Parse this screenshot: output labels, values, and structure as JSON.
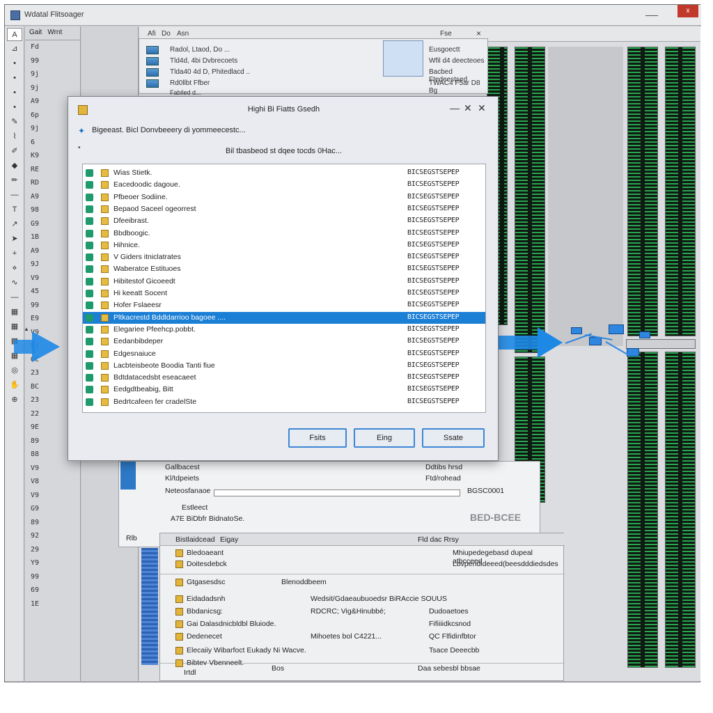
{
  "window": {
    "title": "Wdatal Flitsoager",
    "close_label": "x"
  },
  "left_toolbar": {
    "icons": [
      "t-icon",
      "ruler-icon",
      "dot-icon",
      "dot-icon",
      "dot-icon",
      "dot-icon",
      "pen-icon",
      "brush-icon",
      "pencil-icon",
      "shape-icon",
      "marker-icon",
      "line-icon",
      "text-icon",
      "arrow-icon",
      "cursor-icon",
      "plus-icon",
      "node-icon",
      "smudge-icon",
      "line-icon",
      "grid-icon",
      "grid-icon",
      "grid-icon",
      "grid-icon",
      "circle-icon",
      "hand-icon",
      "zoom-icon"
    ]
  },
  "side_panel": {
    "tabs": [
      "Gait",
      "Wrnt"
    ],
    "rows": [
      "Fd",
      "99",
      "9j",
      "9j",
      "A9",
      "6p",
      "9j",
      "6",
      "K9",
      "RE",
      "RD",
      "A9",
      "98",
      "G9",
      "1B",
      "A9",
      "9J",
      "V9",
      "45",
      "99",
      "E9",
      "V9",
      "9j",
      "GC",
      "23",
      "BC",
      "23",
      "22",
      "9E",
      "89",
      "88",
      "V9",
      "V8",
      "V9",
      "G9",
      "89",
      "92",
      "29",
      "Y9",
      "99",
      "69",
      "1E"
    ]
  },
  "main_menubar": {
    "items": [
      "Afi",
      "Do",
      "Asn",
      "Fse"
    ],
    "close_label": "×"
  },
  "back_window": {
    "items": [
      "Radol, Ltaod, Do ...",
      "Tld4d, 4bi Dvbrecoets",
      "Tlda40 4d D, Phitedlacd ..",
      "Rd0llbt Ffber"
    ],
    "more": "Fabiled d...",
    "right_items": [
      "Eusgoectt",
      "Wfil d4 deecteoes",
      "Bacbed Ftedeestsed",
      "TWAC4 F5ar D8 Bg"
    ]
  },
  "dialog": {
    "title": "Highi Bi Fiatts Gsedh",
    "description": "Bigeeast. Bicl Donvbeeery di yommeecestc...",
    "hint": "Bil tbasbeod st dqee tocds 0Hac...",
    "rows": [
      {
        "name": "Wias Stietk.",
        "code": "BICSEGSTSEPEP"
      },
      {
        "name": "Eacedoodic dagoue.",
        "code": "BICSEGSTSEPEP"
      },
      {
        "name": "Pfbeoer Sodiine.",
        "code": "BICSEGSTSEPEP"
      },
      {
        "name": "Bepaod Saceel ogeorrest",
        "code": "BICSEGSTSEPEP"
      },
      {
        "name": "Dfeeibrast.",
        "code": "BICSEGSTSEPEP"
      },
      {
        "name": "Bbdboogic.",
        "code": "BICSEGSTSEPEP"
      },
      {
        "name": "Hihnice.",
        "code": "BICSEGSTSEPEP"
      },
      {
        "name": "V Giders itniclatrates",
        "code": "BICSEGSTSEPEP"
      },
      {
        "name": "Waberatce Estituoes",
        "code": "BICSEGSTSEPEP"
      },
      {
        "name": "Hibitestof Gicoeedt",
        "code": "BICSEGSTSEPEP"
      },
      {
        "name": "Hi keeatt Socent",
        "code": "BICSEGSTSEPEP"
      },
      {
        "name": "Hofer Fslaeesr",
        "code": "BICSEGSTSEPEP"
      },
      {
        "name": "Pltkacrestd Bddldarrioo bagoee ....",
        "code": "BICSEGSTSEPEP",
        "selected": true
      },
      {
        "name": "Elegariee Pfeehcp.pobbt.",
        "code": "BICSEGSTSEPEP"
      },
      {
        "name": "Eedanbibdeper",
        "code": "BICSEGSTSEPEP"
      },
      {
        "name": "Edgesnaiuce",
        "code": "BICSEGSTSEPEP"
      },
      {
        "name": "Lacbteisbeote Boodia Tanti fiue",
        "code": "BICSEGSTSEPEP"
      },
      {
        "name": "Bdtdatacedsbt eseacaeet",
        "code": "BICSEGSTSEPEP"
      },
      {
        "name": "Eedgdtbeabig, Bitt",
        "code": "BICSEGSTSEPEP"
      },
      {
        "name": "Bedrtcafeen fer cradelSte",
        "code": "BICSEGSTSEPEP"
      }
    ],
    "buttons": [
      "Fsits",
      "Eing",
      "Ssate"
    ]
  },
  "lower_window": {
    "row1_left": "Gallbacest",
    "row1_right": "Ddtibs hrsd",
    "row2_left": "Kl/tdpeiets",
    "row2_right": "Ftd/rohead",
    "row3_left": "Neteosfanaoe",
    "row3_right": "BGSC0001",
    "row4_left": "Estleect",
    "row5_left": "A7E BiDbfr BidnatoSe.",
    "footer_left": "Rlb",
    "badge": "BED-BCEE"
  },
  "props_window": {
    "header_left": "Bistlaidcead",
    "header_mid": "Eigay",
    "header_right": "Fld dac Rrsy",
    "rows": [
      {
        "left": "Bledoaeant",
        "right": "Mhiupedegebasd dupeal atbcceed"
      },
      {
        "left": "Doitesdebck",
        "right": "Lbvpendideeed(beesdddiedsdes"
      },
      {
        "left": "Gtgasesdsc",
        "mid": "Blenoddbeem",
        "right": ""
      },
      {
        "left": "Eidadadsnh",
        "mid": "Wedsit/Gdaeaubuoedsr BiRAccie SOUUS",
        "right": ""
      },
      {
        "left": "Bbdanicsg:",
        "mid": "RDCRC; Vig&Hinubbé;",
        "right": "Dudoaetoes"
      },
      {
        "left": "Gai Dalasdnicbldbl Bluiode.",
        "mid": "",
        "right": "Fifiiiidkcsnod"
      },
      {
        "left": "Dedenecet",
        "mid": "Mihoetes bol C4221...",
        "right": "QC Flfidinfbtor"
      },
      {
        "left": "Elecaiiy Wibarfoct Eukady Ni Wacve.",
        "mid": "",
        "right": "Tsace Deeecbb"
      },
      {
        "left": "Bibtev Vbenneelt.",
        "mid": "",
        "right": ""
      }
    ],
    "footer_left": "Irtdl",
    "footer_mid": "Bos",
    "footer_right": "Daa sebesbl bbsae"
  },
  "colors": {
    "accent": "#1b7fd6",
    "selection": "#1b7fd6",
    "waveform": "#2fbf5a",
    "close": "#c0392b"
  }
}
